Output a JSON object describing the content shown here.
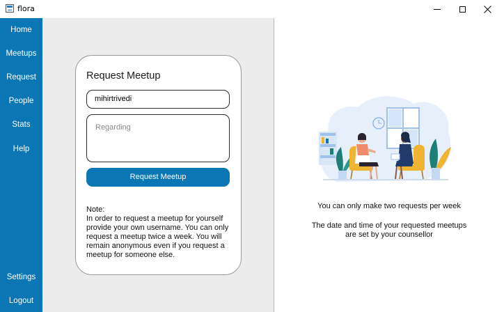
{
  "window": {
    "title": "flora",
    "icon": "app-icon",
    "controls": [
      "minimize-icon",
      "maximize-icon",
      "close-icon"
    ]
  },
  "sidebar": {
    "items": [
      {
        "label": "Home"
      },
      {
        "label": "Meetups"
      },
      {
        "label": "Request"
      },
      {
        "label": "People"
      },
      {
        "label": "Stats"
      },
      {
        "label": "Help"
      }
    ],
    "bottom_items": [
      {
        "label": "Settings"
      },
      {
        "label": "Logout"
      }
    ]
  },
  "form": {
    "title": "Request Meetup",
    "username_value": "mihirtrivedi",
    "regarding_placeholder": "Regarding",
    "submit_label": "Request Meetup",
    "note_heading": "Note:",
    "note_lines": [
      "In order to request a meetup for yourself",
      "provide your own username. You can only",
      "request a meetup twice a week. You will",
      "remain anonymous even if you request a",
      "meetup for someone else."
    ]
  },
  "info": {
    "illustration": "two-women-talking-illustration",
    "line1": "You can only make two requests per week",
    "line2": "The date and time of your requested meetups",
    "line3": "are set by your counsellor"
  },
  "colors": {
    "accent": "#0a76b3",
    "panel_bg": "#ececec"
  }
}
